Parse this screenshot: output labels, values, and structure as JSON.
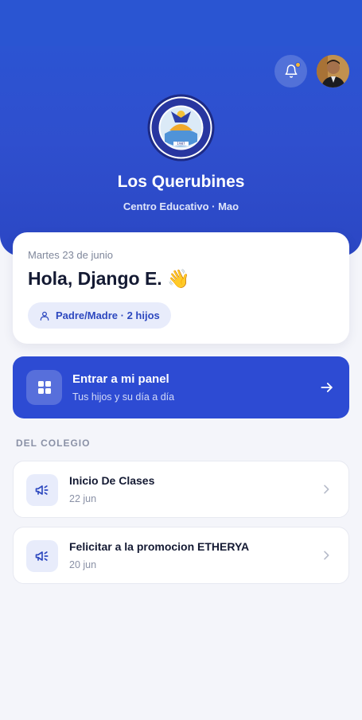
{
  "header": {
    "school_name": "Los Querubines",
    "school_subtitle": "Centro Educativo · Mao",
    "logo_text_top": "CENTRO EDUCATIVO LOS QUERUBINES DE MAO S.R.L.",
    "logo_year": "1987",
    "notification_dot_color": "#f5b731"
  },
  "greeting": {
    "date": "Martes 23 de junio",
    "hello": "Hola, Django E. 👋",
    "role_chip": "Padre/Madre · 2 hijos"
  },
  "panel": {
    "title": "Entrar a mi panel",
    "subtitle": "Tus hijos y su día a día"
  },
  "school_news": {
    "section_title": "DEL COLEGIO",
    "items": [
      {
        "title": "Inicio De Clases",
        "date": "22 jun"
      },
      {
        "title": "Felicitar a la promocion ETHERYA",
        "date": "20 jun"
      }
    ]
  },
  "colors": {
    "primary": "#2d4bd3",
    "background": "#f4f5fa",
    "chip_bg": "#e8ecfb"
  }
}
